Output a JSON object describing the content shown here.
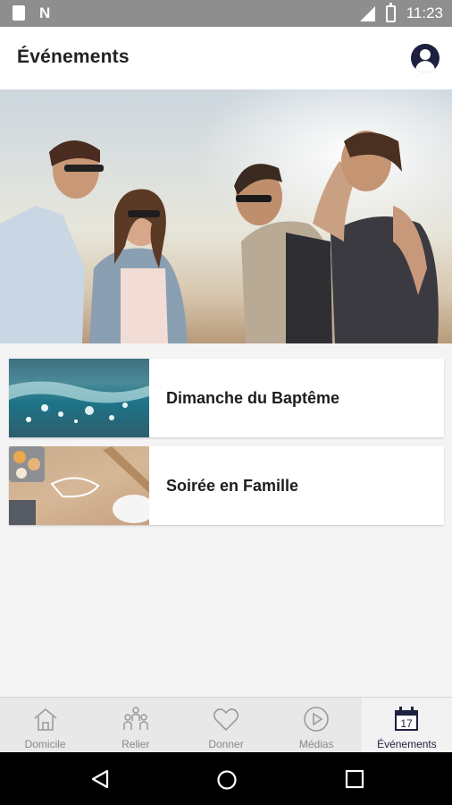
{
  "status_bar": {
    "time": "11:23"
  },
  "header": {
    "title": "Événements"
  },
  "events": [
    {
      "title": "Dimanche du Baptême",
      "thumbnail": "water-splash-image"
    },
    {
      "title": "Soirée en Famille",
      "thumbnail": "family-baking-image"
    }
  ],
  "bottom_nav": [
    {
      "label": "Domicile",
      "icon": "home-icon",
      "active": false
    },
    {
      "label": "Relier",
      "icon": "people-icon",
      "active": false
    },
    {
      "label": "Donner",
      "icon": "heart-icon",
      "active": false
    },
    {
      "label": "Médias",
      "icon": "play-icon",
      "active": false
    },
    {
      "label": "Événements",
      "icon": "calendar-icon",
      "active": true,
      "calendar_day": "17"
    }
  ],
  "colors": {
    "accent": "#1e2040",
    "inactive": "#8a8a8a",
    "background": "#f4f4f4"
  }
}
